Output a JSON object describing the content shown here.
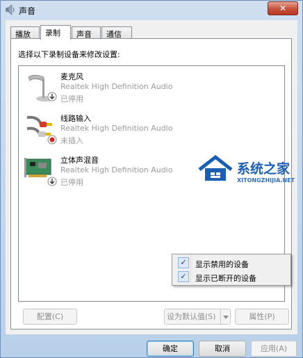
{
  "window": {
    "title": "声音",
    "close_label": "✕"
  },
  "tabs": [
    {
      "label": "播放",
      "active": false
    },
    {
      "label": "录制",
      "active": true
    },
    {
      "label": "声音",
      "active": false
    },
    {
      "label": "通信",
      "active": false
    }
  ],
  "panel": {
    "instruction": "选择以下录制设备来修改设置:"
  },
  "devices": [
    {
      "name": "麦克风",
      "driver": "Realtek High Definition Audio",
      "status": "已停用",
      "icon": "microphone-icon"
    },
    {
      "name": "线路输入",
      "driver": "Realtek High Definition Audio",
      "status": "未插入",
      "icon": "line-in-icon"
    },
    {
      "name": "立体声混音",
      "driver": "Realtek High Definition Audio",
      "status": "已停用",
      "icon": "sound-card-icon"
    }
  ],
  "context_menu": [
    {
      "label": "显示禁用的设备",
      "checked": true
    },
    {
      "label": "显示已断开的设备",
      "checked": true
    }
  ],
  "buttons": {
    "configure": "配置(C)",
    "set_default": "设为默认值(S)",
    "properties": "属性(P)",
    "ok": "确定",
    "cancel": "取消",
    "apply": "应用(A)"
  },
  "watermark": {
    "text": "系统之家",
    "sub": "XITONGZHIJIA.NET"
  },
  "colors": {
    "close": "#c7503a",
    "check": "#1d2fae",
    "watermark": "#1a5fb4"
  }
}
